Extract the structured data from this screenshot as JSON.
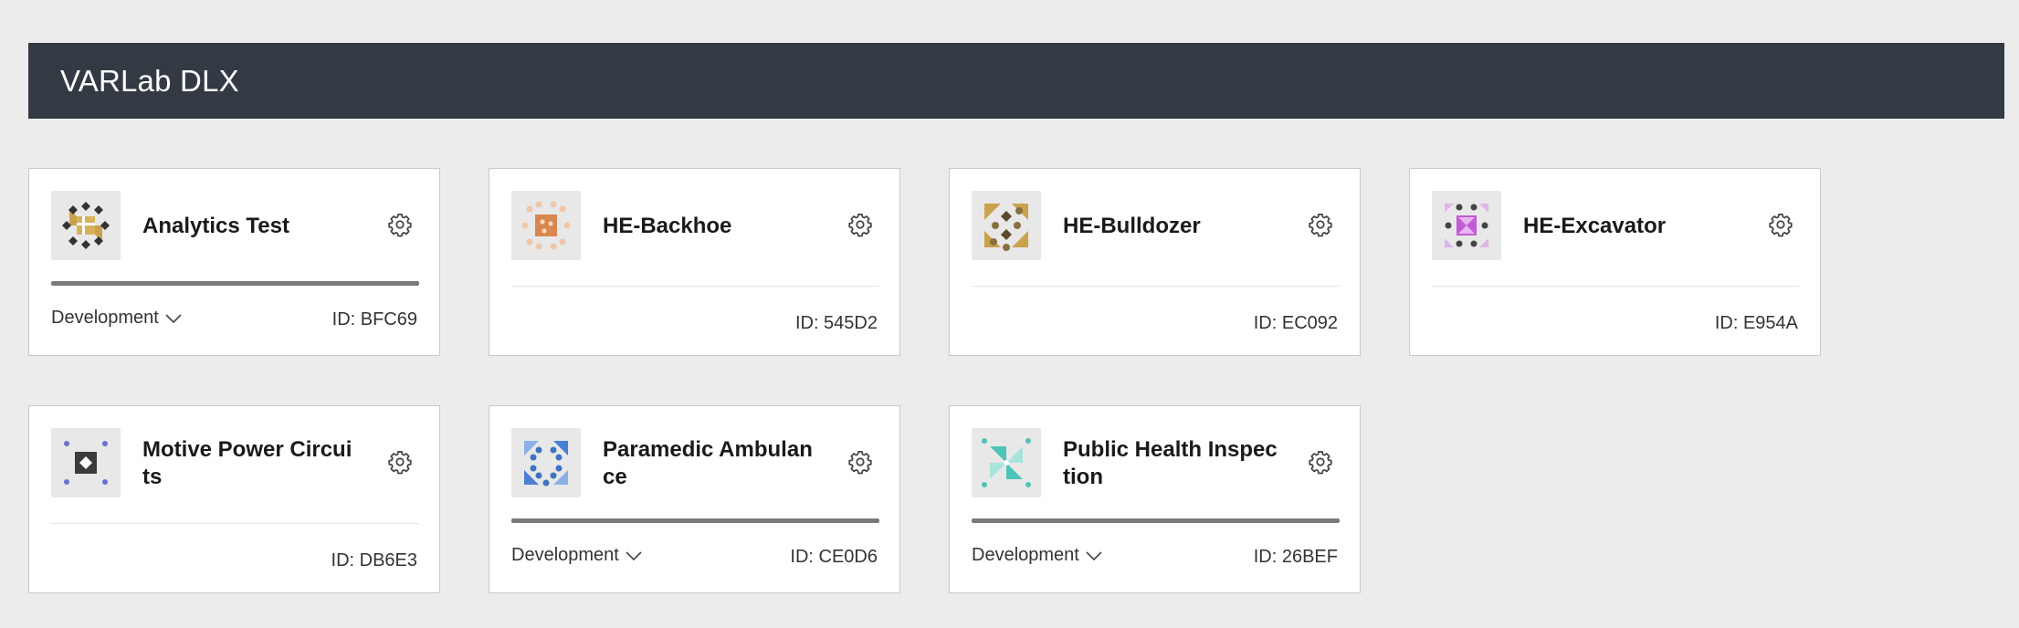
{
  "header": {
    "title": "VARLab DLX"
  },
  "colors": {
    "header_bg": "#343a43",
    "page_bg": "#ececec",
    "card_border": "#c9c9c9"
  },
  "cards": [
    {
      "name": "Analytics Test",
      "environment": "Development",
      "id": "ID: BFC69",
      "icon": "analytics-test-thumbnail"
    },
    {
      "name": "HE-Backhoe",
      "environment": "",
      "id": "ID: 545D2",
      "icon": "he-backhoe-thumbnail"
    },
    {
      "name": "HE-Bulldozer",
      "environment": "",
      "id": "ID: EC092",
      "icon": "he-bulldozer-thumbnail"
    },
    {
      "name": "HE-Excavator",
      "environment": "",
      "id": "ID: E954A",
      "icon": "he-excavator-thumbnail"
    },
    {
      "name": "Motive Power Circuits",
      "environment": "",
      "id": "ID: DB6E3",
      "icon": "motive-power-circuits-thumbnail"
    },
    {
      "name": "Paramedic Ambulance",
      "environment": "Development",
      "id": "ID: CE0D6",
      "icon": "paramedic-ambulance-thumbnail"
    },
    {
      "name": "Public Health Inspection",
      "environment": "Development",
      "id": "ID: 26BEF",
      "icon": "public-health-inspection-thumbnail"
    }
  ]
}
